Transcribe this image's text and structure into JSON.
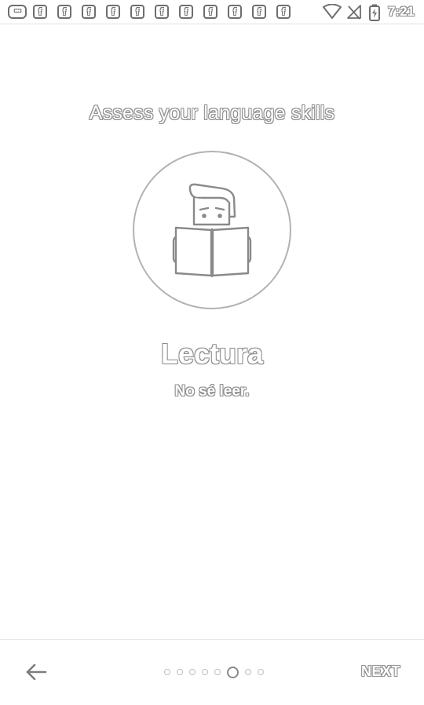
{
  "status_bar": {
    "more_notifications_icon": "ellipsis-icon",
    "notification_icons": [
      "facebook-icon",
      "facebook-icon",
      "facebook-icon",
      "facebook-icon",
      "facebook-icon",
      "facebook-icon",
      "facebook-icon",
      "facebook-icon",
      "facebook-icon",
      "facebook-icon",
      "facebook-icon"
    ],
    "notification_glyph": "f",
    "more_glyph": "•••",
    "wifi_icon": "wifi-icon",
    "signal_icon": "no-signal-icon",
    "battery_icon": "battery-charging-icon",
    "time": "7:21"
  },
  "main": {
    "heading": "Assess your language skills",
    "illustration_icon": "person-reading-book-icon",
    "skill_title": "Lectura",
    "skill_subtitle": "No sé leer."
  },
  "bottom_nav": {
    "back_icon": "arrow-left-icon",
    "page_count": 8,
    "current_page": 6,
    "next_label": "NEXT"
  },
  "colors": {
    "background": "#ffffff",
    "outline": "#8e8e8e",
    "light_outline": "#b2b2b2"
  }
}
